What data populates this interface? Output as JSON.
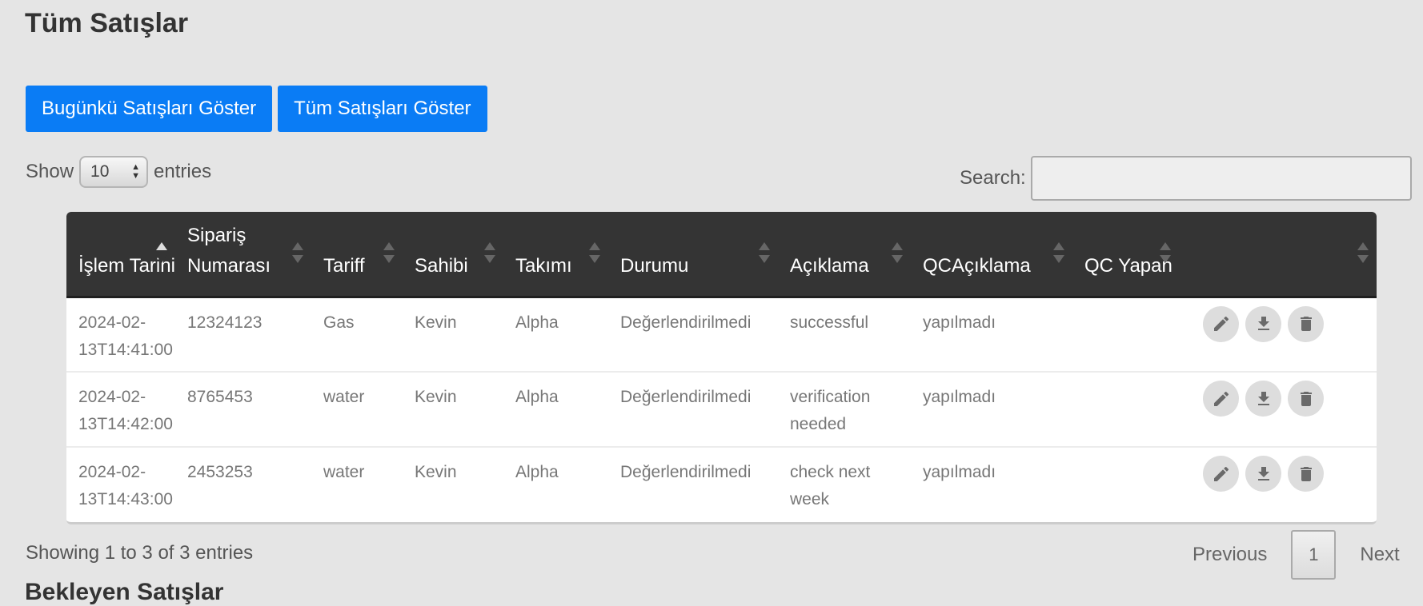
{
  "page": {
    "title": "Tüm Satışlar"
  },
  "buttons": {
    "today": "Bugünkü Satışları Göster",
    "all": "Tüm Satışları Göster"
  },
  "length_control": {
    "prefix": "Show",
    "value": "10",
    "suffix": "entries"
  },
  "search": {
    "label": "Search:",
    "value": ""
  },
  "table": {
    "columns": [
      {
        "label": "İşlem Tarihi",
        "sort": "asc"
      },
      {
        "label": "Sipariş Numarası",
        "sort": "none"
      },
      {
        "label": "Tariff",
        "sort": "none"
      },
      {
        "label": "Sahibi",
        "sort": "none"
      },
      {
        "label": "Takımı",
        "sort": "none"
      },
      {
        "label": "Durumu",
        "sort": "none"
      },
      {
        "label": "Açıklama",
        "sort": "none"
      },
      {
        "label": "QCAçıklama",
        "sort": "none"
      },
      {
        "label": "QC Yapan",
        "sort": "none"
      },
      {
        "label": "",
        "sort": "none"
      }
    ],
    "rows": [
      {
        "date": "2024-02-13T14:41:00",
        "order": "12324123",
        "tariff": "Gas",
        "owner": "Kevin",
        "team": "Alpha",
        "status": "Değerlendirilmedi",
        "desc": "successful",
        "qc_desc": "yapılmadı",
        "qc_by": ""
      },
      {
        "date": "2024-02-13T14:42:00",
        "order": "8765453",
        "tariff": "water",
        "owner": "Kevin",
        "team": "Alpha",
        "status": "Değerlendirilmedi",
        "desc": "verification needed",
        "qc_desc": "yapılmadı",
        "qc_by": ""
      },
      {
        "date": "2024-02-13T14:43:00",
        "order": "2453253",
        "tariff": "water",
        "owner": "Kevin",
        "team": "Alpha",
        "status": "Değerlendirilmedi",
        "desc": "check next week",
        "qc_desc": "yapılmadı",
        "qc_by": ""
      }
    ],
    "row_actions": [
      "pencil-icon",
      "download-icon",
      "trash-icon"
    ]
  },
  "footer": {
    "info": "Showing 1 to 3 of 3 entries",
    "previous": "Previous",
    "current_page": "1",
    "next": "Next"
  },
  "next_section": {
    "title": "Bekleyen Satışlar"
  },
  "colors": {
    "primary_button": "#0a7cf5",
    "table_header": "#343434",
    "background": "#e5e5e5"
  }
}
